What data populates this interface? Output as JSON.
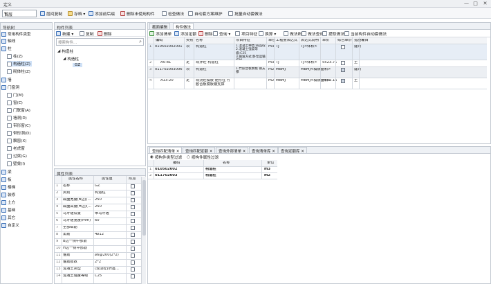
{
  "window": {
    "title": "定义",
    "minimize": "—",
    "restore": "□",
    "close": "✕"
  },
  "toolbar": {
    "combo_value": "首层",
    "items": [
      "层间复制",
      "存档 ▾",
      "添加前后缀",
      "删除未使用构件",
      "检查做法",
      "自动套方案维护",
      "批量自动套做法"
    ]
  },
  "nav": {
    "header": "导航树",
    "items": [
      {
        "label": "常用构件类型"
      },
      {
        "label": "轴线"
      },
      {
        "label": "柱"
      },
      {
        "label": "柱(Z)"
      },
      {
        "label": "构造柱(Z)"
      },
      {
        "label": "砌体柱(Z)"
      },
      {
        "label": "墙"
      },
      {
        "label": "门窗洞"
      },
      {
        "label": "门(M)"
      },
      {
        "label": "窗(C)"
      },
      {
        "label": "门联窗(A)"
      },
      {
        "label": "墙洞(D)"
      },
      {
        "label": "带形窗(C)"
      },
      {
        "label": "带形洞(D)"
      },
      {
        "label": "飘窗(X)"
      },
      {
        "label": "老虎窗"
      },
      {
        "label": "过梁(G)"
      },
      {
        "label": "壁龛(I)"
      },
      {
        "label": "梁"
      },
      {
        "label": "板"
      },
      {
        "label": "楼梯"
      },
      {
        "label": "装修"
      },
      {
        "label": "土方"
      },
      {
        "label": "基础"
      },
      {
        "label": "其它"
      },
      {
        "label": "自定义"
      }
    ]
  },
  "comp_list": {
    "header": "构件列表",
    "new": "新建 ▾",
    "copy": "复制",
    "delete": "删除",
    "search_placeholder": "搜索构件...",
    "tree_root": "构造柱",
    "tree_child": "构造柱",
    "tree_leaf": "GZ"
  },
  "props": {
    "header": "属性列表",
    "col_name": "属性名称",
    "col_value": "属性值",
    "col_extra": "附加",
    "rows": [
      {
        "no": "1",
        "name": "名称",
        "value": "GZ",
        "chk": false
      },
      {
        "no": "2",
        "name": "类别",
        "value": "构造柱",
        "chk": false
      },
      {
        "no": "3",
        "name": "截面宽度(B边)(...",
        "value": "250",
        "chk": false
      },
      {
        "no": "4",
        "name": "截面高度(H边)(...",
        "value": "250",
        "chk": false
      },
      {
        "no": "5",
        "name": "马牙槎设置",
        "value": "带马牙槎",
        "chk": false
      },
      {
        "no": "6",
        "name": "马牙槎宽度(mm)",
        "value": "60",
        "chk": false
      },
      {
        "no": "7",
        "name": "全部纵筋",
        "value": "",
        "chk": false
      },
      {
        "no": "8",
        "name": "角筋",
        "value": "4⌀12",
        "chk": false
      },
      {
        "no": "9",
        "name": "B边一侧中部筋",
        "value": "",
        "chk": false
      },
      {
        "no": "10",
        "name": "H边一侧中部筋",
        "value": "",
        "chk": false
      },
      {
        "no": "11",
        "name": "箍筋",
        "value": "⌀6@200(2*2)",
        "chk": false
      },
      {
        "no": "12",
        "name": "箍筋肢数",
        "value": "2*2",
        "chk": false
      },
      {
        "no": "13",
        "name": "混凝土类型",
        "value": "(现浇砼(坍落...",
        "chk": false
      },
      {
        "no": "14",
        "name": "混凝土强度等级",
        "value": "C25",
        "chk": false
      }
    ]
  },
  "main_tabs": {
    "tab1": "截面编辑",
    "tab2": "构件做法"
  },
  "main_toolbar": [
    "添加清单",
    "添加定额",
    "删除",
    "查询 ▾",
    "项目特征",
    "换算 ▾",
    "做法刷",
    "做法查询",
    "提取做法",
    "当前构件自动套做法"
  ],
  "table": {
    "headers": [
      "编码",
      "类别",
      "名称",
      "项目特征",
      "单位",
      "工程量表达式",
      "表达式说明",
      "单价",
      "综合单价",
      "措施项目",
      "专"
    ],
    "rows": [
      {
        "no": "1",
        "code": "010502002001",
        "type": "项",
        "name": "构造柱",
        "feature": "1.混凝土种类:商品砼\n2.混凝土强度等级:C25\n3.输送方式:卧泵运输机械",
        "unit": "m3",
        "expr": "TJ",
        "desc": "TJ<体积>",
        "price": "",
        "total": "",
        "chk": false,
        "spec": "建筑"
      },
      {
        "no": "2",
        "code": "A5-81",
        "type": "定",
        "name": "现拌砼 构造柱",
        "feature": "",
        "unit": "m3",
        "expr": "TJ",
        "desc": "TJ<体积>",
        "price": "5523.71",
        "total": "",
        "chk": false,
        "spec": "土"
      },
      {
        "no": "3",
        "code": "011702003006",
        "type": "项",
        "name": "构造柱",
        "feature": "1.竹胶合板模板 钢支撑",
        "unit": "m2",
        "expr": "MBMJ",
        "desc": "MBMJ<模板面积>",
        "price": "",
        "total": "",
        "chk": true,
        "spec": "建筑"
      },
      {
        "no": "4",
        "code": "A13-20",
        "type": "定",
        "name": "现浇砼模板 矩形柱 竹胶合板模板钢支撑",
        "feature": "",
        "unit": "m2",
        "expr": "MBMJ",
        "desc": "MBMJ<模板面积>",
        "price": "4002.15",
        "total": "",
        "chk": true,
        "spec": "土"
      }
    ]
  },
  "bottom": {
    "tabs": [
      "查询匹配清单 ✕",
      "查询匹配定额 ✕",
      "查询外部清单 ✕",
      "查询清单库 ✕",
      "查询定额库 ✕"
    ],
    "filter1": "按构件类型过滤",
    "filter2": "按构件属性过滤",
    "headers": [
      "编码",
      "名称",
      "单位"
    ],
    "rows": [
      {
        "no": "1",
        "code": "010502002",
        "name": "构造柱",
        "unit": "m3"
      },
      {
        "no": "2",
        "code": "011702003",
        "name": "构造柱",
        "unit": "m2"
      }
    ]
  }
}
